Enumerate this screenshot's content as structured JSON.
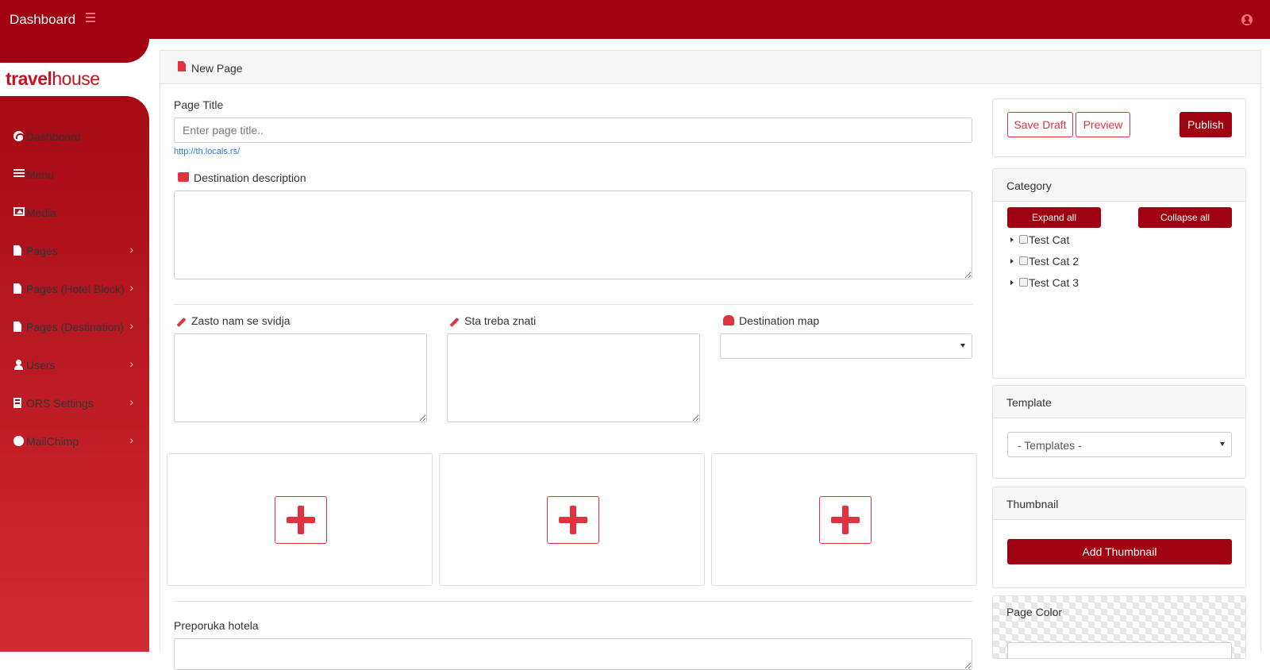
{
  "header": {
    "title": "Dashboard"
  },
  "brand": {
    "part1": "travel",
    "part2": "house"
  },
  "sidebar": {
    "items": [
      {
        "label": "Dashboard",
        "icon": "dashboard-icon"
      },
      {
        "label": "Menu",
        "icon": "bars-icon"
      },
      {
        "label": "Media",
        "icon": "image-icon"
      },
      {
        "label": "Pages",
        "icon": "file-icon"
      },
      {
        "label": "Pages (Hotel Block)",
        "icon": "file-icon"
      },
      {
        "label": "Pages (Destination)",
        "icon": "file-icon"
      },
      {
        "label": "Users",
        "icon": "user-icon"
      },
      {
        "label": "ORS Settings",
        "icon": "building-icon"
      },
      {
        "label": "MailChimp",
        "icon": "globe-icon"
      }
    ]
  },
  "panel": {
    "title": "New Page"
  },
  "form": {
    "page_title_label": "Page Title",
    "page_title_placeholder": "Enter page title..",
    "page_title_value": "",
    "url_prefix": "http://th.locals.rs/",
    "destination_description_label": "Destination description",
    "zasto_label": "Zasto nam se svidja",
    "sta_label": "Sta treba znati",
    "map_label": "Destination map",
    "map_value": "",
    "preporuka_label": "Preporuka hotela"
  },
  "publish": {
    "save_draft": "Save Draft",
    "preview": "Preview",
    "publish": "Publish"
  },
  "category": {
    "title": "Category",
    "expand_all": "Expand all",
    "collapse_all": "Collapse all",
    "items": [
      "Test Cat",
      "Test Cat 2",
      "Test Cat 3"
    ]
  },
  "template": {
    "title": "Template",
    "selected": "- Templates -"
  },
  "thumbnail": {
    "title": "Thumbnail",
    "button": "Add Thumbnail"
  },
  "page_color": {
    "title": "Page Color"
  },
  "colors": {
    "brand": "#a0000f",
    "accent": "#e0323f"
  }
}
